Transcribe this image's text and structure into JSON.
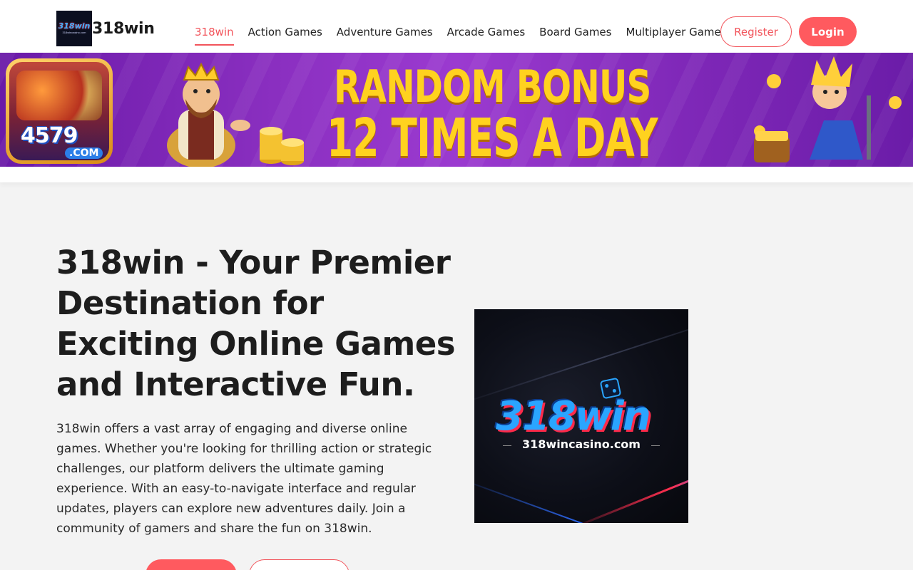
{
  "header": {
    "brand": "318win",
    "logo_mini": "318win",
    "logo_tiny": "318wincasino.com",
    "nav": [
      {
        "label": "318win",
        "active": true
      },
      {
        "label": "Action Games",
        "active": false
      },
      {
        "label": "Adventure Games",
        "active": false
      },
      {
        "label": "Arcade Games",
        "active": false
      },
      {
        "label": "Board Games",
        "active": false
      },
      {
        "label": "Multiplayer Games",
        "active": false
      }
    ],
    "register_label": "Register",
    "login_label": "Login"
  },
  "banner": {
    "badge_number": "4579",
    "badge_domain": ".COM",
    "line1": "RANDOM BONUS",
    "line2": "12 TIMES A DAY"
  },
  "main": {
    "title": "318win - Your Premier Destination for Exciting Online Games and Interactive Fun.",
    "description": "318win offers a vast array of engaging and diverse online games. Whether you're looking for thrilling action or strategic challenges, our platform delivers the ultimate gaming experience. With an easy-to-navigate interface and regular updates, players can explore new adventures daily. Join a community of gamers and share the fun on 318win.",
    "hero_image": {
      "brand": "318win",
      "url": "318wincasino.com"
    }
  },
  "colors": {
    "accent": "#ff5a5f",
    "banner_purple": "#8a2fc0",
    "banner_text": "#ffd21f"
  }
}
